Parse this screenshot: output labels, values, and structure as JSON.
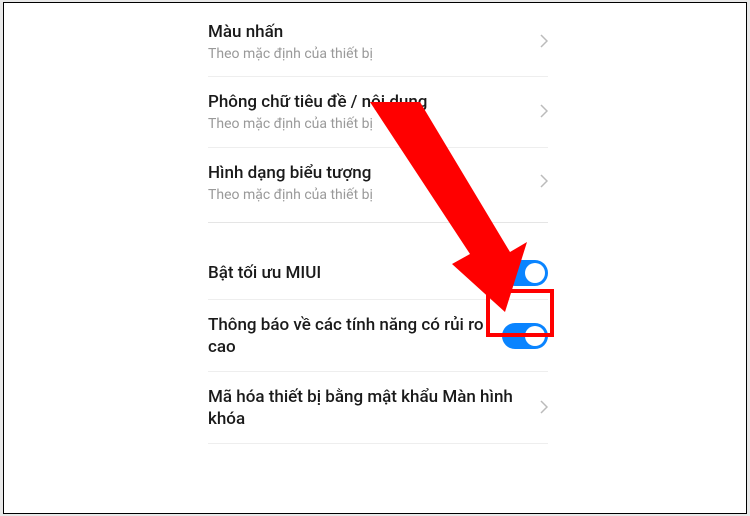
{
  "settings": {
    "group1": [
      {
        "title": "Màu nhấn",
        "subtitle": "Theo mặc định của thiết bị"
      },
      {
        "title": "Phông chữ tiêu đề / nội dung",
        "subtitle": "Theo mặc định của thiết bị"
      },
      {
        "title": "Hình dạng biểu tượng",
        "subtitle": "Theo mặc định của thiết bị"
      }
    ],
    "group2": [
      {
        "title": "Bật tối ưu MIUI"
      },
      {
        "title": "Thông báo về các tính năng có rủi ro cao"
      },
      {
        "title": "Mã hóa thiết bị bằng mật khẩu Màn hình khóa"
      }
    ]
  }
}
